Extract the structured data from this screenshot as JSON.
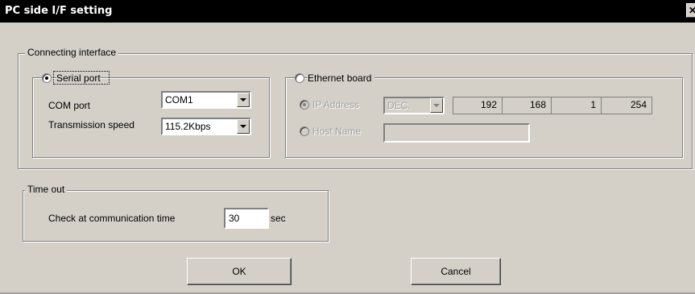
{
  "window": {
    "title": "PC side I/F setting",
    "close_glyph": "✕"
  },
  "connecting_interface": {
    "legend": "Connecting interface",
    "serial": {
      "label": "Serial port",
      "selected": true,
      "com_port_label": "COM port",
      "com_port_value": "COM1",
      "speed_label": "Transmission speed",
      "speed_value": "115.2Kbps"
    },
    "ethernet": {
      "label": "Ethernet board",
      "selected": false,
      "ip_label": "IP Address",
      "ip_format": "DEC.",
      "ip_octets": [
        "192",
        "168",
        "1",
        "254"
      ],
      "host_label": "Host Name",
      "host_value": ""
    }
  },
  "timeout": {
    "legend": "Time out",
    "check_label": "Check at communication time",
    "value": "30",
    "unit": "sec"
  },
  "buttons": {
    "ok": "OK",
    "cancel": "Cancel"
  }
}
